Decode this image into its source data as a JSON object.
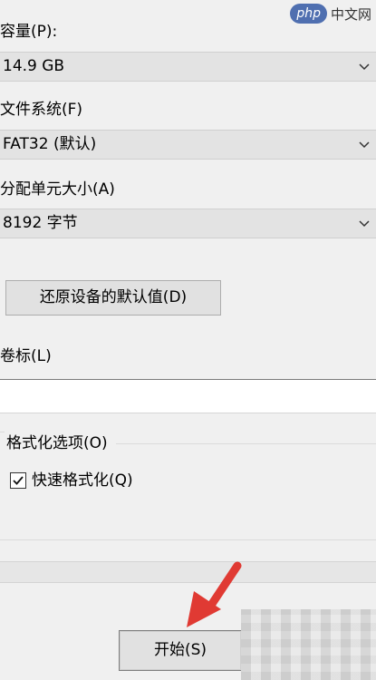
{
  "watermark": {
    "badge": "php",
    "text": "中文网"
  },
  "capacity": {
    "label": "容量(P):",
    "value": "14.9 GB"
  },
  "file_system": {
    "label": "文件系统(F)",
    "value": "FAT32 (默认)"
  },
  "allocation": {
    "label": "分配单元大小(A)",
    "value": "8192 字节"
  },
  "restore_button": {
    "label": "还原设备的默认值(D)"
  },
  "volume": {
    "label": "卷标(L)",
    "value": ""
  },
  "format_options": {
    "title": "格式化选项(O)",
    "quick_format": {
      "label": "快速格式化(Q)",
      "checked": true
    }
  },
  "start_button": {
    "label": "开始(S)"
  },
  "colors": {
    "arrow": "#e03a33",
    "dropdown_bg": "#e3e3e3",
    "button_bg": "#e1e1e1",
    "logo_bg": "#4f6fb0"
  },
  "icons": {
    "dropdown": "chevron-down-icon",
    "check": "check-icon",
    "annotation": "red-arrow-icon"
  }
}
